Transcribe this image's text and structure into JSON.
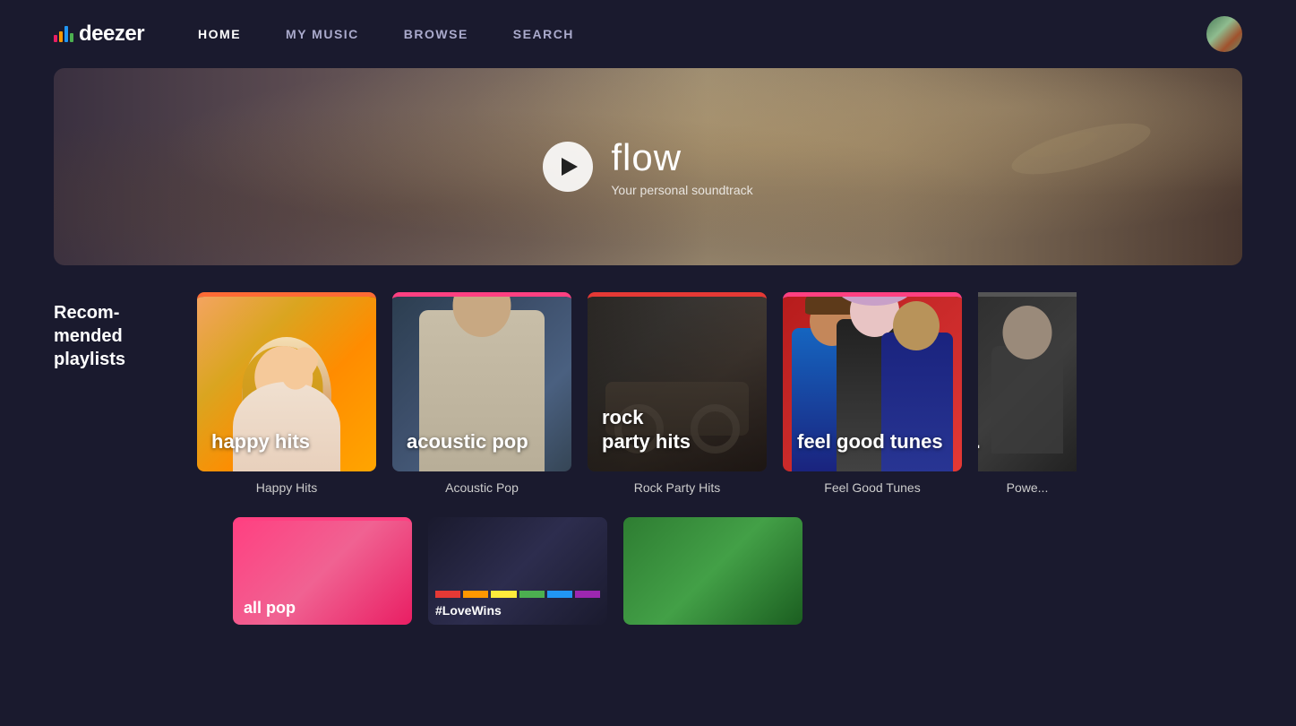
{
  "header": {
    "logo_text": "deezer",
    "nav_items": [
      {
        "label": "HOME",
        "active": true
      },
      {
        "label": "MY MUSIC",
        "active": false
      },
      {
        "label": "BROWSE",
        "active": false
      },
      {
        "label": "SEARCH",
        "active": false
      }
    ]
  },
  "hero": {
    "title": "flow",
    "subtitle": "Your personal soundtrack"
  },
  "recommended": {
    "section_label": "Recom-\nmended\nplaylists",
    "playlists": [
      {
        "id": "happy-hits",
        "name": "Happy Hits",
        "overlay": "happy hits",
        "color_top": "orange"
      },
      {
        "id": "acoustic-pop",
        "name": "Acoustic Pop",
        "overlay": "acoustic pop",
        "color_top": "pink"
      },
      {
        "id": "rock-party-hits",
        "name": "Rock Party Hits",
        "overlay": "rock\nparty hits",
        "color_top": "red"
      },
      {
        "id": "feel-good-tunes",
        "name": "Feel Good Tunes",
        "overlay": "feel good tunes",
        "color_top": "red"
      },
      {
        "id": "power-partial",
        "name": "Powe...",
        "overlay": "p...",
        "color_top": "none"
      }
    ]
  },
  "bottom_row": {
    "items": [
      {
        "id": "all-pop",
        "label": "all pop"
      },
      {
        "id": "love-wins",
        "label": "#LoveWins"
      },
      {
        "id": "green-playlist",
        "label": ""
      }
    ]
  },
  "logo_bars": [
    {
      "height": 8,
      "color": "#e91e63"
    },
    {
      "height": 12,
      "color": "#ff9800"
    },
    {
      "height": 16,
      "color": "#2196f3"
    },
    {
      "height": 10,
      "color": "#4caf50"
    }
  ]
}
